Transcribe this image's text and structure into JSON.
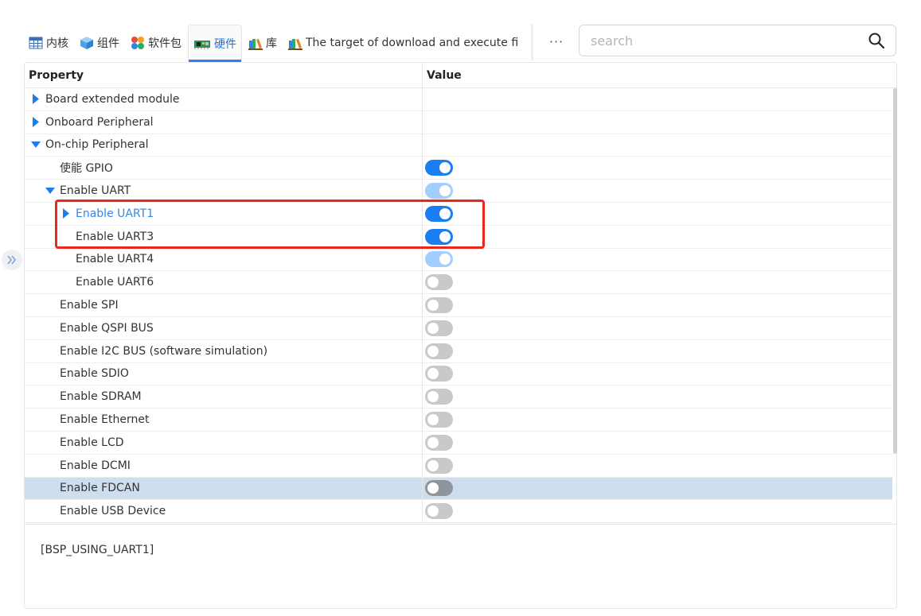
{
  "tabs": [
    {
      "label": "内核",
      "icon": "table-icon",
      "active": false
    },
    {
      "label": "组件",
      "icon": "cube-icon",
      "active": false
    },
    {
      "label": "软件包",
      "icon": "puzzle-icon",
      "active": false
    },
    {
      "label": "硬件",
      "icon": "board-icon",
      "active": true
    },
    {
      "label": "库",
      "icon": "books-icon",
      "active": false
    },
    {
      "label": "The target of download and execute fi",
      "icon": "books-icon",
      "active": false
    }
  ],
  "more_label": "···",
  "search": {
    "placeholder": "search",
    "value": ""
  },
  "table": {
    "headers": {
      "property": "Property",
      "value": "Value"
    },
    "rows": [
      {
        "label": "Board extended module",
        "level": 0,
        "caret": "collapsed",
        "toggle": null
      },
      {
        "label": "Onboard Peripheral",
        "level": 0,
        "caret": "collapsed",
        "toggle": null
      },
      {
        "label": "On-chip Peripheral",
        "level": 0,
        "caret": "expanded",
        "toggle": null
      },
      {
        "label": "使能 GPIO",
        "level": 1,
        "caret": "none",
        "toggle": "on"
      },
      {
        "label": "Enable UART",
        "level": 1,
        "caret": "expanded",
        "toggle": "on-disabled"
      },
      {
        "label": "Enable UART1",
        "level": 2,
        "caret": "collapsed",
        "toggle": "on",
        "link": true
      },
      {
        "label": "Enable UART3",
        "level": 2,
        "caret": "none",
        "toggle": "on"
      },
      {
        "label": "Enable UART4",
        "level": 2,
        "caret": "none",
        "toggle": "on-disabled"
      },
      {
        "label": "Enable UART6",
        "level": 2,
        "caret": "none",
        "toggle": "off"
      },
      {
        "label": "Enable SPI",
        "level": 1,
        "caret": "none",
        "toggle": "off"
      },
      {
        "label": "Enable QSPI BUS",
        "level": 1,
        "caret": "none",
        "toggle": "off"
      },
      {
        "label": "Enable I2C BUS (software simulation)",
        "level": 1,
        "caret": "none",
        "toggle": "off"
      },
      {
        "label": "Enable SDIO",
        "level": 1,
        "caret": "none",
        "toggle": "off"
      },
      {
        "label": "Enable SDRAM",
        "level": 1,
        "caret": "none",
        "toggle": "off"
      },
      {
        "label": "Enable Ethernet",
        "level": 1,
        "caret": "none",
        "toggle": "off"
      },
      {
        "label": "Enable LCD",
        "level": 1,
        "caret": "none",
        "toggle": "off"
      },
      {
        "label": "Enable DCMI",
        "level": 1,
        "caret": "none",
        "toggle": "off"
      },
      {
        "label": "Enable FDCAN",
        "level": 1,
        "caret": "none",
        "toggle": "off",
        "selected": true
      },
      {
        "label": "Enable USB Device",
        "level": 1,
        "caret": "none",
        "toggle": "off"
      }
    ]
  },
  "macro_text": "[BSP_USING_UART1]",
  "colors": {
    "accent": "#1a7ef0",
    "accent_disabled": "#a3ceff",
    "toggle_off": "#c9c9c9",
    "selected_row": "#cfdeee",
    "highlight_box": "#e8281e",
    "link_text": "#2f8ae8"
  }
}
